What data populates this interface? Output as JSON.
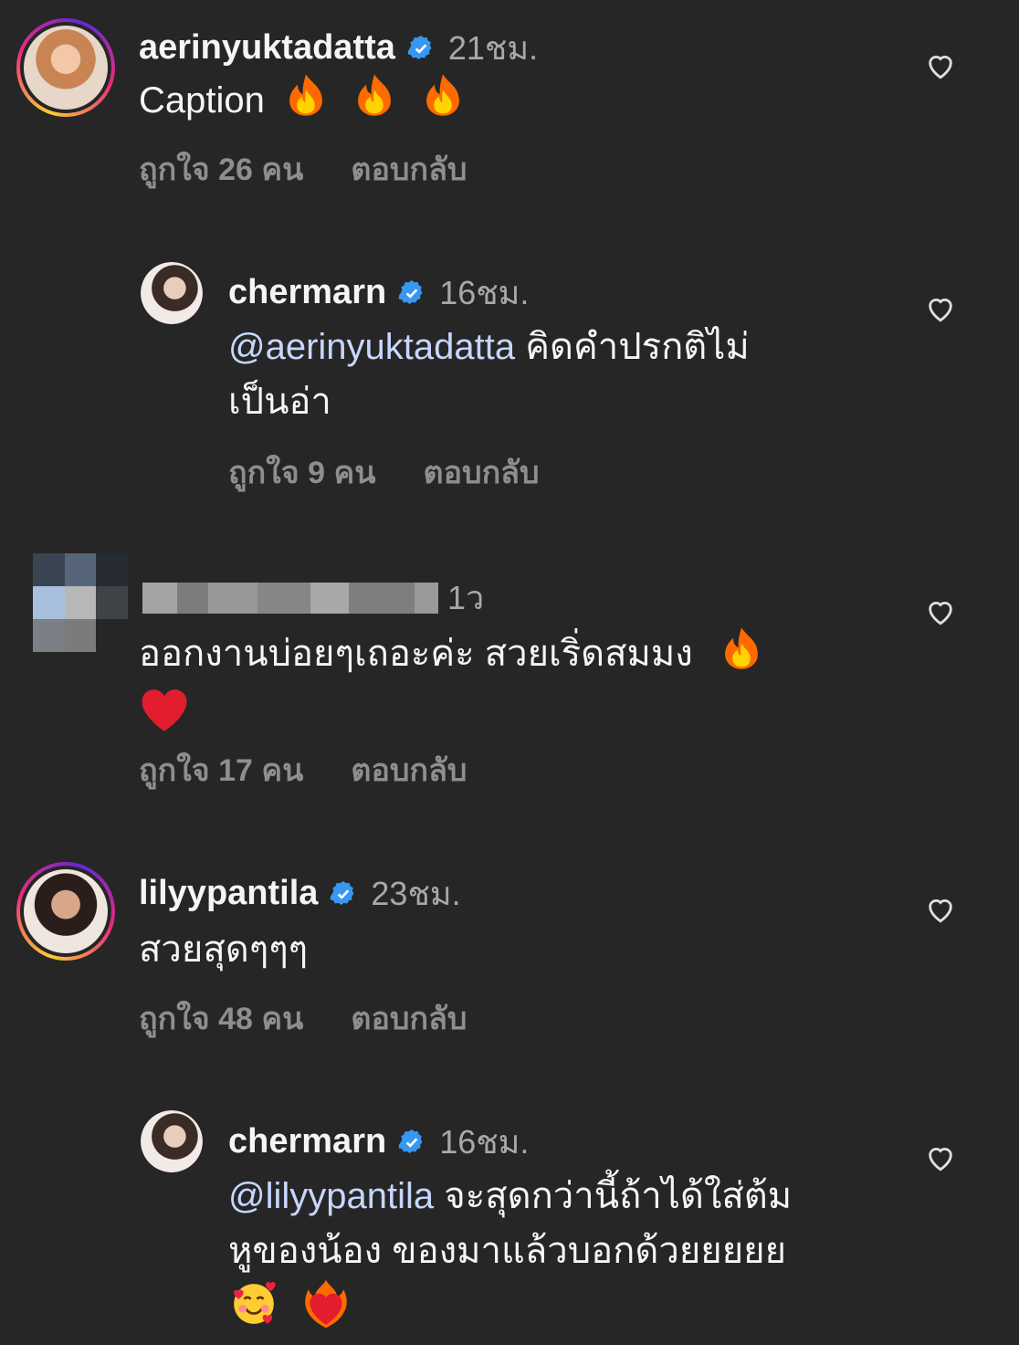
{
  "comments": [
    {
      "username": "aerinyuktadatta",
      "time": "21ชม.",
      "text": "Caption",
      "likes": "ถูกใจ 26 คน",
      "reply": "ตอบกลับ",
      "emoji": [
        "fire-emoji",
        "fire-emoji",
        "fire-emoji"
      ],
      "verified": true
    },
    {
      "username": "chermarn",
      "time": "16ชม.",
      "mention": "@aerinyuktadatta",
      "text_line1": "คิดคำปรกติไม่",
      "text_line2": "เป็นอ่า",
      "likes": "ถูกใจ 9 คน",
      "reply": "ตอบกลับ",
      "verified": true
    },
    {
      "time": "1ว",
      "text": "ออกงานบ่อยๆเถอะค่ะ สวยเริ่ดสมมง",
      "likes": "ถูกใจ 17 คน",
      "reply": "ตอบกลับ",
      "emoji": [
        "fire-emoji",
        "red-heart-emoji"
      ],
      "verified": false
    },
    {
      "username": "lilyypantila",
      "time": "23ชม.",
      "text": "สวยสุดๆๆๆ",
      "likes": "ถูกใจ 48 คน",
      "reply": "ตอบกลับ",
      "verified": true
    },
    {
      "username": "chermarn",
      "time": "16ชม.",
      "mention": "@lilyypantila",
      "text_line1": "จะสุดกว่านี้ถ้าได้ใส่ต้ม",
      "text_line2": "หูของน้อง ของมาแล้วบอกด้วยยยยย",
      "emoji": [
        "smiling-face-with-hearts-emoji",
        "heart-on-fire-emoji"
      ],
      "verified": true
    }
  ],
  "colors": {
    "background": "#262626",
    "text": "#f5f5f5",
    "secondary": "#8e8e8e",
    "verified": "#3897f0",
    "mention": "#c7d6ff"
  }
}
